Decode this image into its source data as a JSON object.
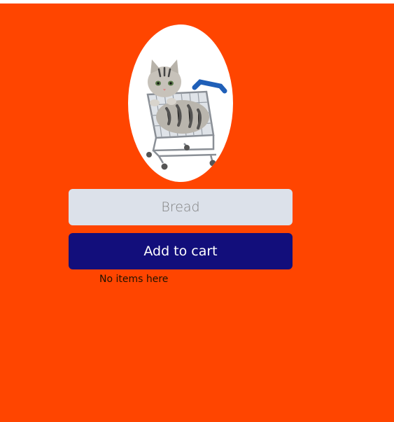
{
  "colors": {
    "background": "#ff4500",
    "input_fill": "#dce1ea",
    "button_fill": "#120e7b",
    "button_text": "#ffffff"
  },
  "hero_image": {
    "icon": "kitten-in-shopping-cart"
  },
  "item_input": {
    "placeholder": "Bread",
    "value": ""
  },
  "add_button": {
    "label": "Add to cart"
  },
  "cart": {
    "empty_message": "No items here"
  }
}
